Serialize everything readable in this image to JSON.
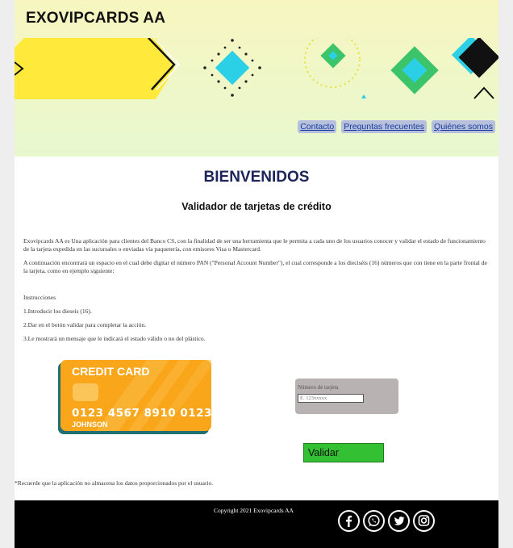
{
  "header": {
    "brand": "EXOVIPCARDS AA",
    "nav": [
      "Contacto",
      "Preguntas frecuentes",
      "Quiénes somos"
    ]
  },
  "main": {
    "welcome": "BIENVENIDOS",
    "subtitle": "Validador de tarjetas de crédito",
    "intro_1": "Exovipcards AA es Una aplicación para clientes del Banco CS, con la finalidad de ser una herramienta que le permita a cada uno de los usuarios conocer y validar el estado de funcionamiento de la tarjeta expedida en las sucursales o enviadas vía paquetería, con emisores Visa o Mastercard.",
    "intro_2": "A continuación encontrará un espacio en el cual debe digitar el número PAN (\"Personal Account Number\"), el cual corresponde a los dieciséis (16) números que con tiene en la parte frontal de la tarjeta, como en ejemplo siguiente:",
    "instructions_title": "Instrucciones",
    "steps": [
      "1.Introducir los dieseis (16).",
      "2.Dar en el botón validar para completar la acción.",
      "3.Le mostrará un mensaje que le indicará el estado válido o no del plástico."
    ]
  },
  "card": {
    "title": "CREDIT CARD",
    "number": "0123 4567 8910 0123",
    "holder": "JOHNSON",
    "color": "#f9a61a"
  },
  "validator": {
    "label": "Número de tarjeta",
    "placeholder": "E. 123xxxxx",
    "button": "Validar"
  },
  "note": "*Recuerde que la aplicación no almacena los datos proporcionados por el usuario.",
  "footer": {
    "copyright": "Copyright 2021 Exovipcards AA",
    "social_icons": [
      "facebook-icon",
      "whatsapp-icon",
      "twitter-icon",
      "instagram-icon"
    ]
  }
}
